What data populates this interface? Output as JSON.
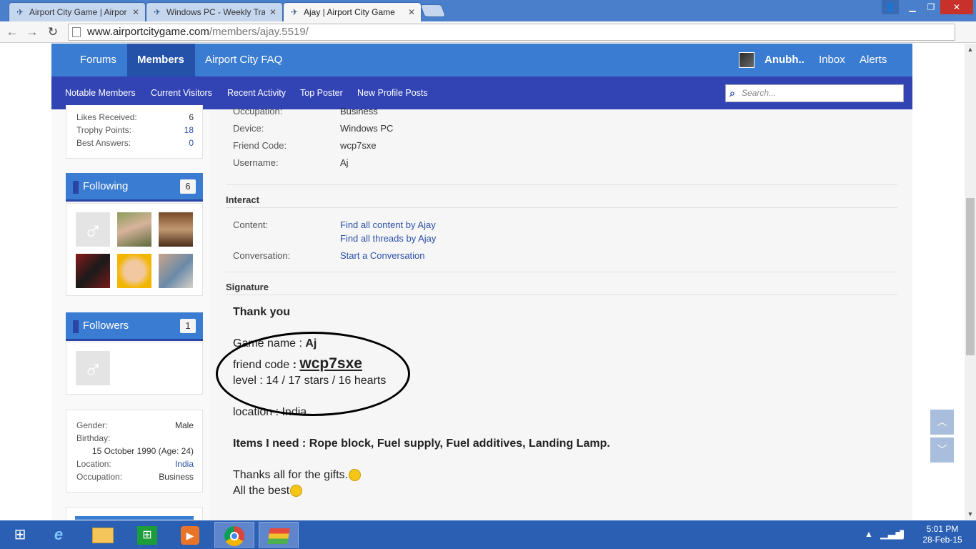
{
  "browser": {
    "tabs": [
      {
        "title": "Airport City Game | Airpor",
        "active": false
      },
      {
        "title": "Windows PC - Weekly Tra",
        "active": false
      },
      {
        "title": "Ajay | Airport City Game",
        "active": true
      }
    ],
    "url_host": "www.airportcitygame.com",
    "url_path": "/members/ajay.5519/"
  },
  "nav": {
    "tabs": [
      "Forums",
      "Members",
      "Airport City FAQ"
    ],
    "selected": "Members",
    "user_name": "Anubh..",
    "inbox": "Inbox",
    "alerts": "Alerts",
    "subnav": [
      "Notable Members",
      "Current Visitors",
      "Recent Activity",
      "Top Poster",
      "New Profile Posts"
    ],
    "search_placeholder": "Search..."
  },
  "sidebar": {
    "stats": [
      {
        "label": "Likes Received:",
        "value": "6"
      },
      {
        "label": "Trophy Points:",
        "value": "18"
      },
      {
        "label": "Best Answers:",
        "value": "0"
      }
    ],
    "following": {
      "title": "Following",
      "count": "6"
    },
    "followers": {
      "title": "Followers",
      "count": "1"
    },
    "info": {
      "gender_label": "Gender:",
      "gender": "Male",
      "birthday_label": "Birthday:",
      "birthday": "15 October 1990 (Age: 24)",
      "location_label": "Location:",
      "location": "India",
      "occupation_label": "Occupation:",
      "occupation": "Business"
    }
  },
  "profile": {
    "fields": [
      {
        "label": "Occupation:",
        "value": "Business"
      },
      {
        "label": "Device:",
        "value": "Windows PC"
      },
      {
        "label": "Friend Code:",
        "value": "wcp7sxe"
      },
      {
        "label": "Username:",
        "value": "Aj"
      }
    ],
    "interact_title": "Interact",
    "content_label": "Content:",
    "content_links": [
      "Find all content by Ajay",
      "Find all threads by Ajay"
    ],
    "conversation_label": "Conversation:",
    "conversation_link": "Start a Conversation",
    "signature_title": "Signature"
  },
  "signature": {
    "thank_you": "Thank you",
    "game_name_label": "Game name : ",
    "game_name": "Aj",
    "friend_code_label": "friend code ",
    "friend_code_sep": ": ",
    "friend_code": "wcp7sxe",
    "level": "level : 14 / 17 stars / 16 hearts",
    "location": "location : India",
    "items": "Items I need : Rope block, Fuel supply, Fuel additives, Landing Lamp.",
    "thanks": "Thanks all for the gifts.",
    "best": "All the best"
  },
  "taskbar": {
    "time": "5:01 PM",
    "date": "28-Feb-15"
  },
  "colors": {
    "nav_blue": "#3a7cd1",
    "subnav_blue": "#3244b4",
    "selected_tab": "#2352a8",
    "link": "#2b50a8"
  }
}
